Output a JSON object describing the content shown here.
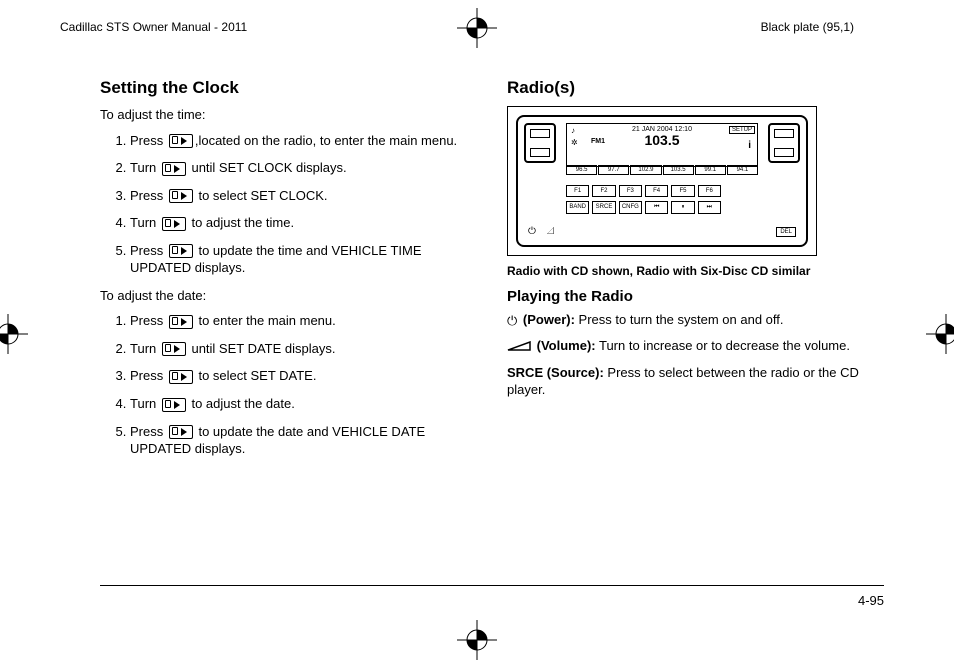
{
  "header": {
    "left": "Cadillac STS Owner Manual - 2011",
    "right": "Black plate (95,1)"
  },
  "left_col": {
    "h2": "Setting the Clock",
    "intro1": "To adjust the time:",
    "time_steps": [
      {
        "pre": "Press ",
        "post": ",located on the radio, to enter the main menu."
      },
      {
        "pre": "Turn ",
        "post": " until SET CLOCK displays."
      },
      {
        "pre": "Press ",
        "post": " to select SET CLOCK."
      },
      {
        "pre": "Turn ",
        "post": " to adjust the time."
      },
      {
        "pre": "Press ",
        "post": " to update the time and VEHICLE TIME UPDATED displays."
      }
    ],
    "intro2": "To adjust the date:",
    "date_steps": [
      {
        "pre": "Press ",
        "post": " to enter the main menu."
      },
      {
        "pre": "Turn ",
        "post": " until SET DATE displays."
      },
      {
        "pre": "Press ",
        "post": " to select SET DATE."
      },
      {
        "pre": "Turn ",
        "post": " to adjust the date."
      },
      {
        "pre": "Press ",
        "post": " to update the date and VEHICLE DATE UPDATED displays."
      }
    ]
  },
  "right_col": {
    "h2": "Radio(s)",
    "radio": {
      "date": "21 JAN 2004 12:10",
      "band": "FM1",
      "freq": "103.5",
      "setup": "SETUP",
      "info": "i",
      "presets": [
        "96.5",
        "97.7",
        "102.9",
        "103.5",
        "99.1",
        "94.1"
      ],
      "row1": [
        "F1",
        "F2",
        "F3",
        "F4",
        "F5",
        "F6"
      ],
      "row2": [
        "BAND",
        "SRCE",
        "CNFG",
        "⏮",
        "⏸",
        "⏭"
      ],
      "del": "DEL"
    },
    "caption": "Radio with CD shown, Radio with Six-Disc CD similar",
    "h3": "Playing the Radio",
    "power_label": "(Power):",
    "power_text": " Press to turn the system on and off.",
    "volume_label": "(Volume):",
    "volume_text": " Turn to increase or to decrease the volume.",
    "srce_label": "SRCE (Source):",
    "srce_text": " Press to select between the radio or the CD player."
  },
  "footer": {
    "page": "4-95"
  }
}
